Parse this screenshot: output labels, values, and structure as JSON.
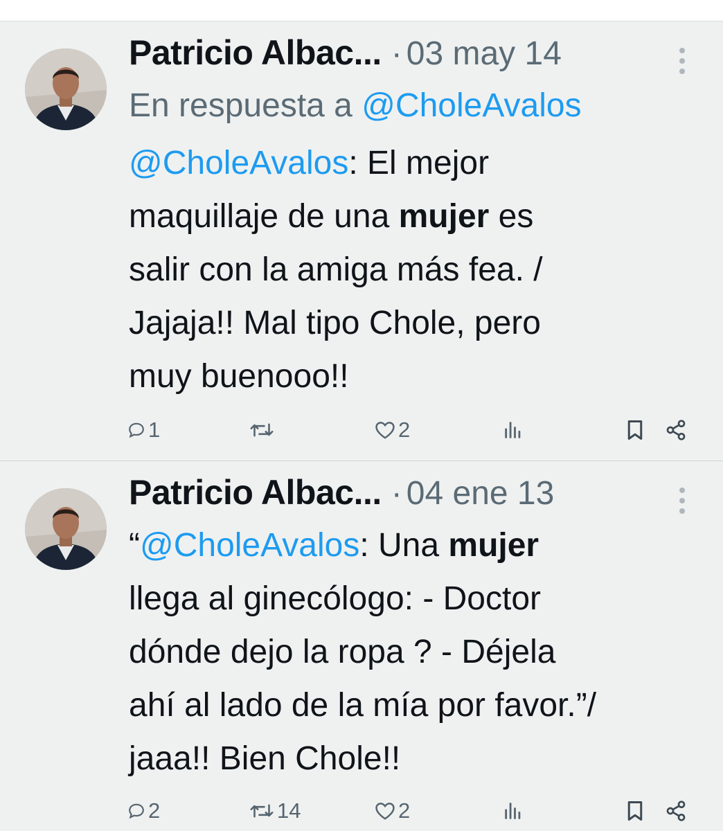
{
  "colors": {
    "background": "#eff1f1",
    "link": "#1d9bf0",
    "muted": "#5b6b75",
    "text": "#0f1419"
  },
  "tweets": [
    {
      "author": "Patricio Albac...",
      "separator": "·",
      "date": "03 may 14",
      "reply_prefix": "En respuesta a",
      "reply_handle": "@CholeAvalos",
      "body": {
        "l1_mention": "@CholeAvalos",
        "l1_rest": ": El mejor",
        "l2_a": "maquillaje de una ",
        "l2_bold": "mujer",
        "l2_b": " es",
        "l3": "salir con la amiga más fea. /",
        "l4": "Jajaja!! Mal tipo Chole, pero",
        "l5": "muy buenooo!!"
      },
      "actions": {
        "replies": "1",
        "retweets": "",
        "likes": "2"
      },
      "icons": [
        "reply-icon",
        "retweet-icon",
        "like-icon",
        "views-icon",
        "bookmark-icon",
        "share-icon",
        "more-icon"
      ]
    },
    {
      "author": "Patricio Albac...",
      "separator": "·",
      "date": "04 ene 13",
      "body": {
        "l1_quote": "“",
        "l1_mention": "@CholeAvalos",
        "l1_a": ": Una ",
        "l1_bold": "mujer",
        "l2": "llega al ginecólogo: - Doctor",
        "l3": "dónde dejo la ropa ? - Déjela",
        "l4": "ahí al lado de la mía por favor.”/",
        "l5": "jaaa!! Bien Chole!!"
      },
      "actions": {
        "replies": "2",
        "retweets": "14",
        "likes": "2"
      },
      "icons": [
        "reply-icon",
        "retweet-icon",
        "like-icon",
        "views-icon",
        "bookmark-icon",
        "share-icon",
        "more-icon"
      ]
    }
  ]
}
